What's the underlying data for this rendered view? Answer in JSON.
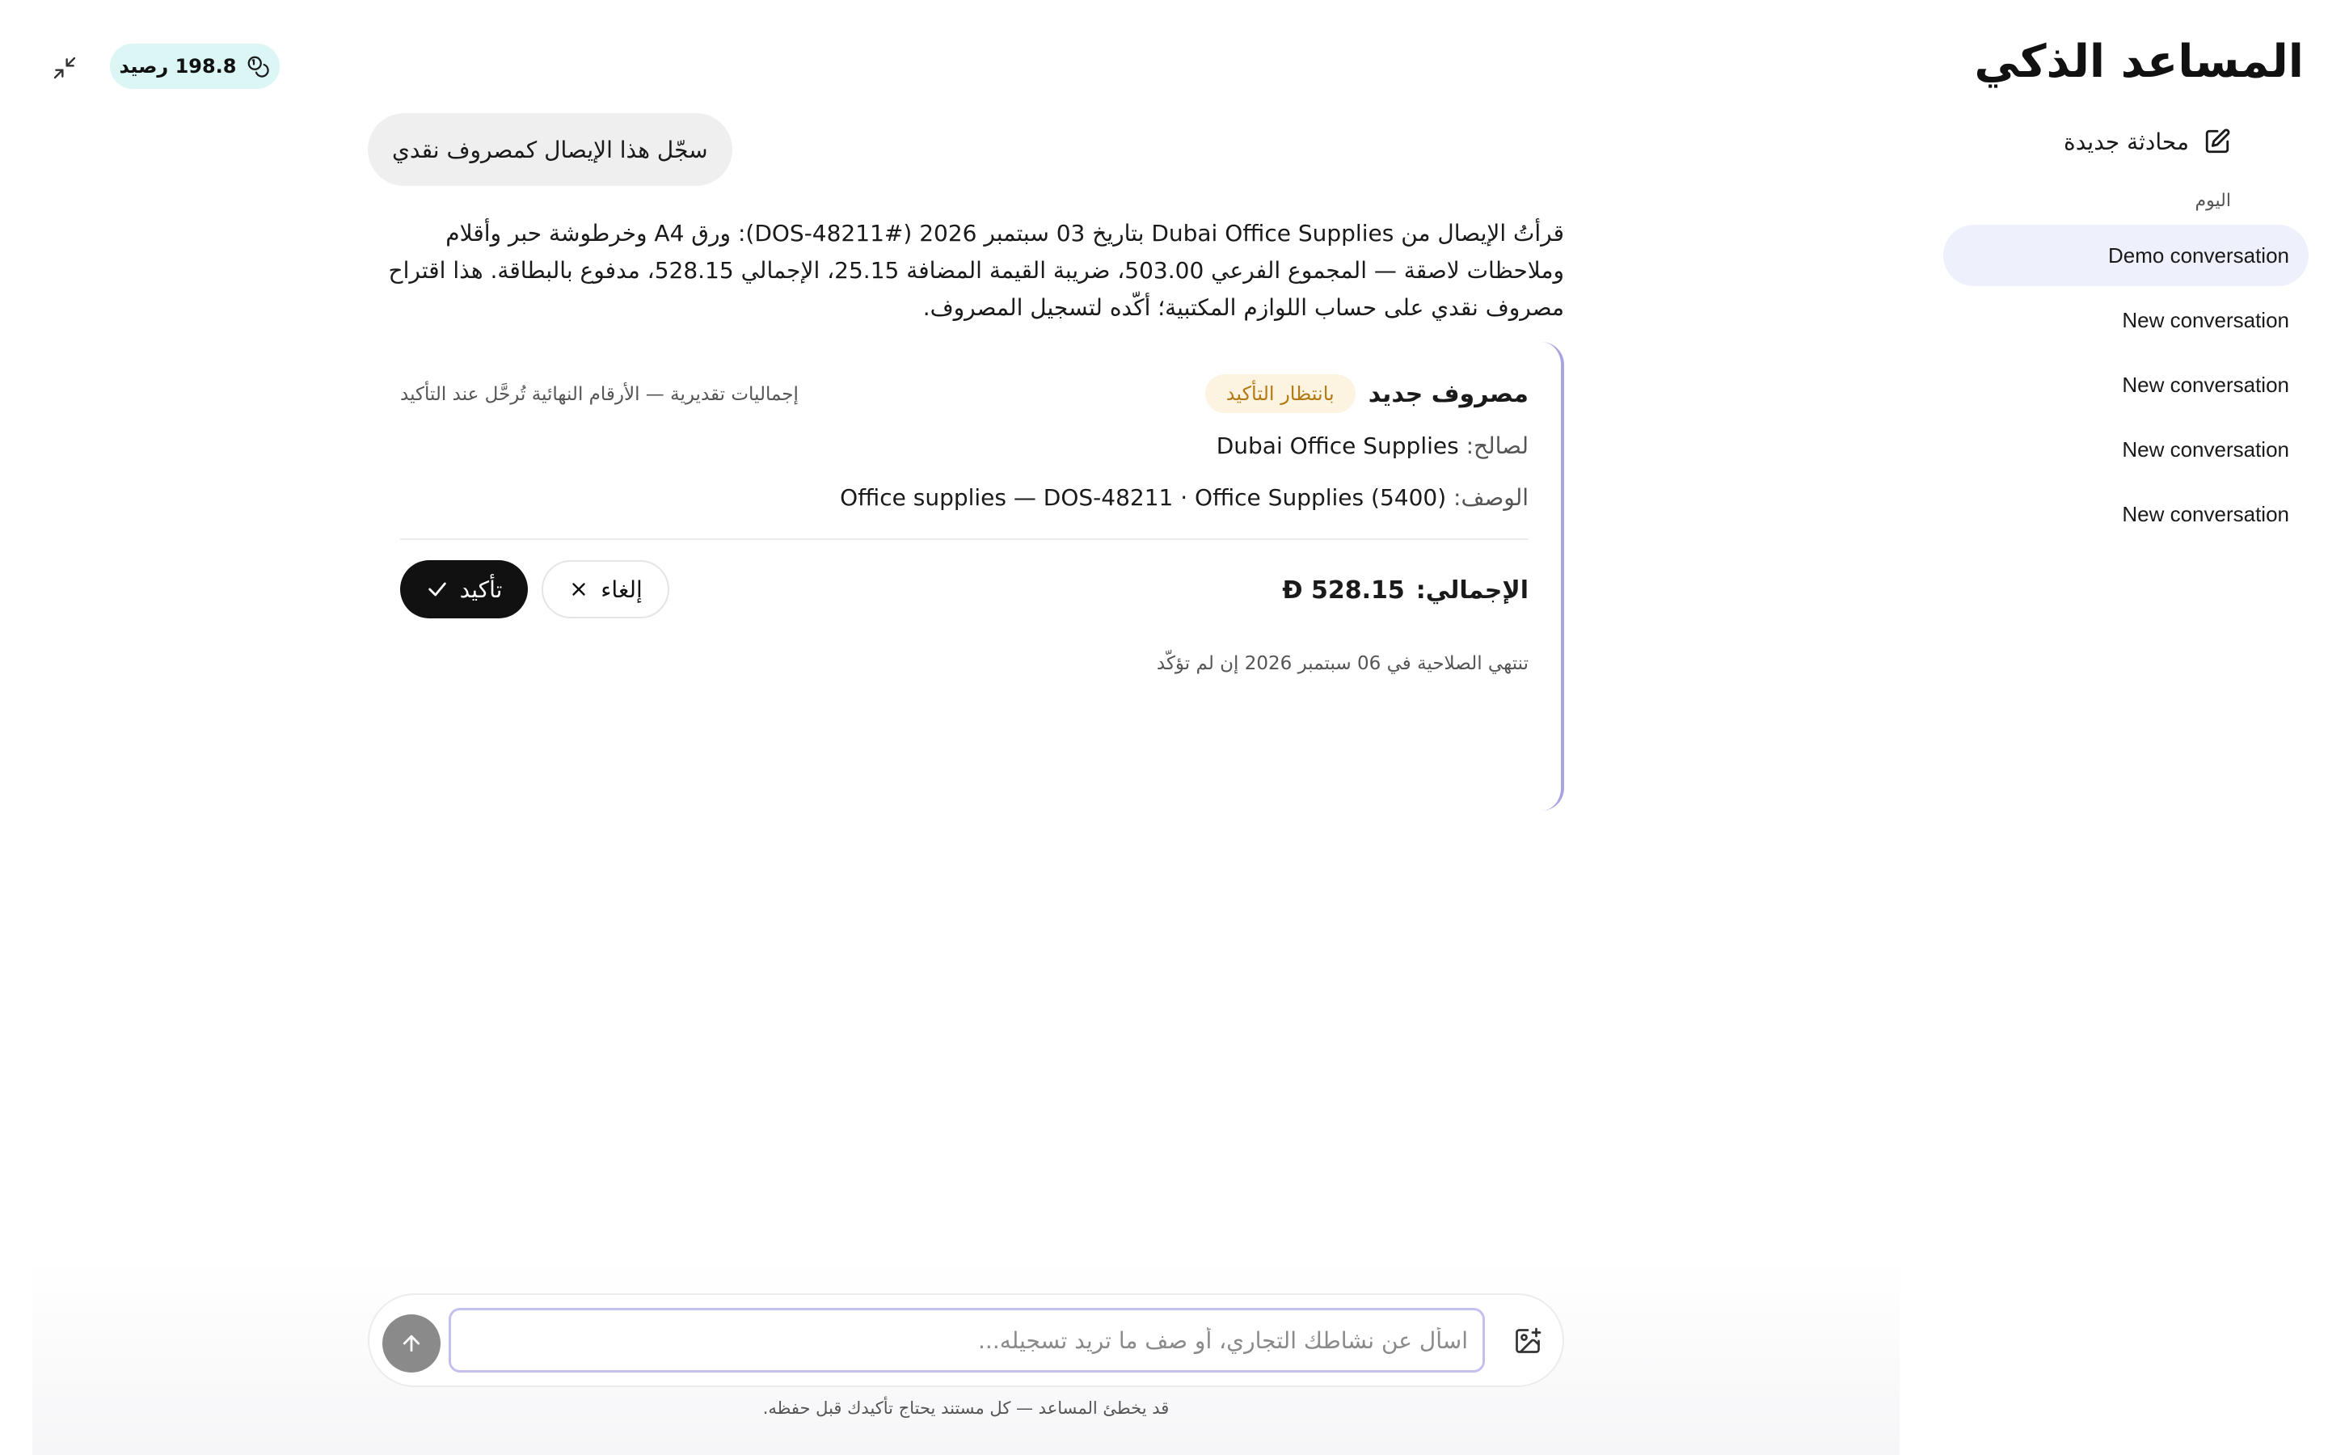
{
  "app": {
    "title": "المساعد الذكي"
  },
  "sidebar": {
    "new_chat_label": "محادثة جديدة",
    "section_today": "اليوم",
    "conversations": [
      {
        "label": "Demo conversation",
        "active": true
      },
      {
        "label": "New conversation",
        "active": false
      },
      {
        "label": "New conversation",
        "active": false
      },
      {
        "label": "New conversation",
        "active": false
      },
      {
        "label": "New conversation",
        "active": false
      }
    ]
  },
  "topbar": {
    "credits": "198.8 رصيد",
    "collapse_icon": "collapse-icon",
    "credit_icon": "coins-icon"
  },
  "chat": {
    "user_message": "سجّل هذا الإيصال كمصروف نقدي",
    "assistant_message": "قرأتُ الإيصال من Dubai Office Supplies بتاريخ 03 سبتمبر 2026 (#DOS-48211): ورق A4 وخرطوشة حبر وأقلام وملاحظات لاصقة — المجموع الفرعي 503.00، ضريبة القيمة المضافة 25.15، الإجمالي 528.15، مدفوع بالبطاقة. هذا اقتراح مصروف نقدي على حساب اللوازم المكتبية؛ أكّده لتسجيل المصروف."
  },
  "expense_card": {
    "title": "مصروف جديد",
    "status": "بانتظار التأكيد",
    "estimate_note": "إجماليات تقديرية — الأرقام النهائية تُرحَّل عند التأكيد",
    "vendor_label": "لصالح:",
    "vendor_value": "Dubai Office Supplies",
    "description_label": "الوصف:",
    "description_value": "Office supplies — DOS-48211 · Office Supplies (5400)",
    "total_label": "الإجمالي:",
    "total_value": "528.15",
    "currency_symbol": "Đ",
    "confirm_label": "تأكيد",
    "cancel_label": "إلغاء",
    "expiry_note": "تنتهي الصلاحية في 06 سبتمبر 2026 إن لم تؤكّد",
    "accent_color": "#a8a4e0",
    "status_bg": "#fdf3e1",
    "status_color": "#b27a14"
  },
  "composer": {
    "placeholder": "اسأل عن نشاطك التجاري، أو صف ما تريد تسجيله...",
    "value": "",
    "disclaimer": "قد يخطئ المساعد — كل مستند يحتاج تأكيدك قبل حفظه."
  }
}
